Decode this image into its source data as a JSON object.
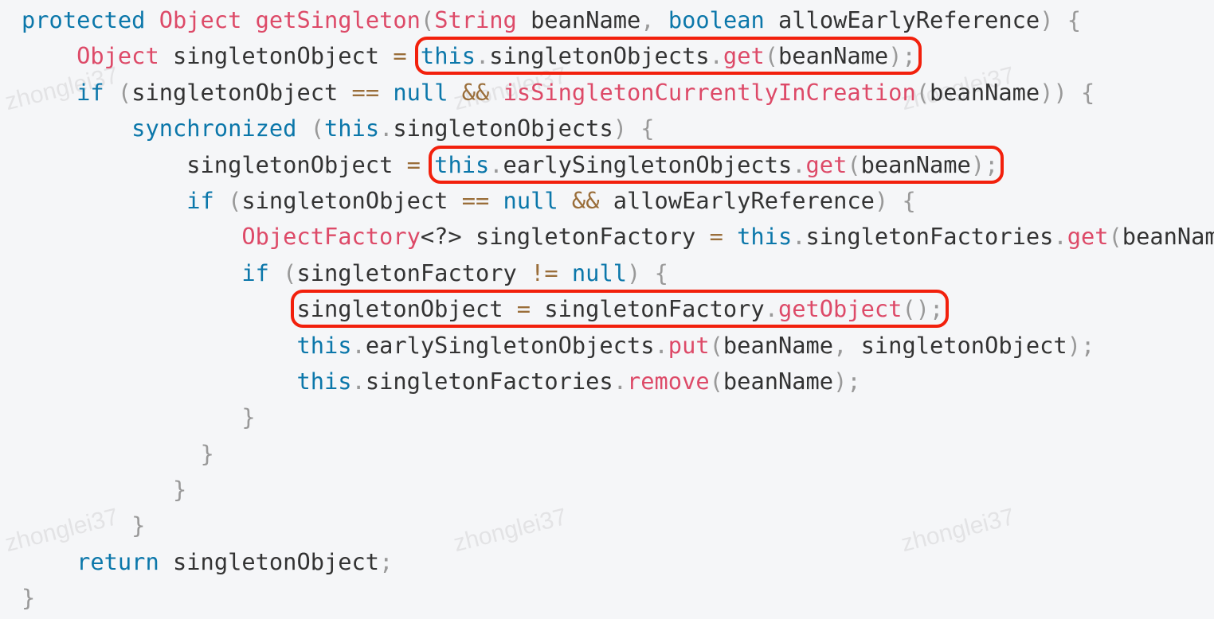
{
  "colors": {
    "keyword": "#0b77aa",
    "function": "#dd4a68",
    "operator": "#9a6e3a",
    "punctuation": "#999999",
    "text": "#333333",
    "highlight_box": "#f2200c",
    "background": "#f5f6f8"
  },
  "watermark": "zhonglei37",
  "code": [
    {
      "indent": 0,
      "tokens": [
        [
          "kw",
          "protected"
        ],
        [
          "t",
          " "
        ],
        [
          "fn",
          "Object"
        ],
        [
          "t",
          " "
        ],
        [
          "fn",
          "getSingleton"
        ],
        [
          "p",
          "("
        ],
        [
          "fn",
          "String"
        ],
        [
          "t",
          " beanName"
        ],
        [
          "p",
          ","
        ],
        [
          "t",
          " "
        ],
        [
          "kw",
          "boolean"
        ],
        [
          "t",
          " allowEarlyReference"
        ],
        [
          "p",
          ")"
        ],
        [
          "t",
          " "
        ],
        [
          "p",
          "{"
        ]
      ]
    },
    {
      "indent": 4,
      "tokens": [
        [
          "fn",
          "Object"
        ],
        [
          "t",
          " singletonObject "
        ],
        [
          "op",
          "="
        ],
        [
          "t",
          " "
        ],
        [
          "kw",
          "this"
        ],
        [
          "p",
          "."
        ],
        [
          "t",
          "singletonObjects"
        ],
        [
          "p",
          "."
        ],
        [
          "fn",
          "get"
        ],
        [
          "p",
          "("
        ],
        [
          "t",
          "beanName"
        ],
        [
          "p",
          ")"
        ],
        [
          "p",
          ";"
        ]
      ],
      "box": [
        4,
        12
      ]
    },
    {
      "indent": 4,
      "tokens": [
        [
          "kw",
          "if"
        ],
        [
          "t",
          " "
        ],
        [
          "p",
          "("
        ],
        [
          "t",
          "singletonObject "
        ],
        [
          "op",
          "=="
        ],
        [
          "t",
          " "
        ],
        [
          "kw",
          "null"
        ],
        [
          "t",
          " "
        ],
        [
          "op",
          "&&"
        ],
        [
          "t",
          " "
        ],
        [
          "fn",
          "isSingletonCurrentlyInCreation"
        ],
        [
          "p",
          "("
        ],
        [
          "t",
          "beanName"
        ],
        [
          "p",
          ")"
        ],
        [
          "p",
          ")"
        ],
        [
          "t",
          " "
        ],
        [
          "p",
          "{"
        ]
      ]
    },
    {
      "indent": 8,
      "tokens": [
        [
          "kw",
          "synchronized"
        ],
        [
          "t",
          " "
        ],
        [
          "p",
          "("
        ],
        [
          "kw",
          "this"
        ],
        [
          "p",
          "."
        ],
        [
          "t",
          "singletonObjects"
        ],
        [
          "p",
          ")"
        ],
        [
          "t",
          " "
        ],
        [
          "p",
          "{"
        ]
      ]
    },
    {
      "indent": 12,
      "tokens": [
        [
          "t",
          "singletonObject "
        ],
        [
          "op",
          "="
        ],
        [
          "t",
          " "
        ],
        [
          "kw",
          "this"
        ],
        [
          "p",
          "."
        ],
        [
          "t",
          "earlySingletonObjects"
        ],
        [
          "p",
          "."
        ],
        [
          "fn",
          "get"
        ],
        [
          "p",
          "("
        ],
        [
          "t",
          "beanName"
        ],
        [
          "p",
          ")"
        ],
        [
          "p",
          ";"
        ]
      ],
      "box": [
        3,
        11
      ]
    },
    {
      "indent": 12,
      "tokens": [
        [
          "kw",
          "if"
        ],
        [
          "t",
          " "
        ],
        [
          "p",
          "("
        ],
        [
          "t",
          "singletonObject "
        ],
        [
          "op",
          "=="
        ],
        [
          "t",
          " "
        ],
        [
          "kw",
          "null"
        ],
        [
          "t",
          " "
        ],
        [
          "op",
          "&&"
        ],
        [
          "t",
          " allowEarlyReference"
        ],
        [
          "p",
          ")"
        ],
        [
          "t",
          " "
        ],
        [
          "p",
          "{"
        ]
      ]
    },
    {
      "indent": 16,
      "tokens": [
        [
          "fn",
          "ObjectFactory"
        ],
        [
          "t",
          "<?> singletonFactory "
        ],
        [
          "op",
          "="
        ],
        [
          "t",
          " "
        ],
        [
          "kw",
          "this"
        ],
        [
          "p",
          "."
        ],
        [
          "t",
          "singletonFactories"
        ],
        [
          "p",
          "."
        ],
        [
          "fn",
          "get"
        ],
        [
          "p",
          "("
        ],
        [
          "t",
          "beanNam"
        ]
      ]
    },
    {
      "indent": 16,
      "tokens": [
        [
          "kw",
          "if"
        ],
        [
          "t",
          " "
        ],
        [
          "p",
          "("
        ],
        [
          "t",
          "singletonFactory "
        ],
        [
          "op",
          "!="
        ],
        [
          "t",
          " "
        ],
        [
          "kw",
          "null"
        ],
        [
          "p",
          ")"
        ],
        [
          "t",
          " "
        ],
        [
          "p",
          "{"
        ]
      ]
    },
    {
      "indent": 20,
      "tokens": [
        [
          "t",
          "singletonObject "
        ],
        [
          "op",
          "="
        ],
        [
          "t",
          " singletonFactory"
        ],
        [
          "p",
          "."
        ],
        [
          "fn",
          "getObject"
        ],
        [
          "p",
          "("
        ],
        [
          "p",
          ")"
        ],
        [
          "p",
          ";"
        ]
      ],
      "box": [
        0,
        7
      ]
    },
    {
      "indent": 20,
      "tokens": [
        [
          "kw",
          "this"
        ],
        [
          "p",
          "."
        ],
        [
          "t",
          "earlySingletonObjects"
        ],
        [
          "p",
          "."
        ],
        [
          "fn",
          "put"
        ],
        [
          "p",
          "("
        ],
        [
          "t",
          "beanName"
        ],
        [
          "p",
          ","
        ],
        [
          "t",
          " singletonObject"
        ],
        [
          "p",
          ")"
        ],
        [
          "p",
          ";"
        ]
      ]
    },
    {
      "indent": 20,
      "tokens": [
        [
          "kw",
          "this"
        ],
        [
          "p",
          "."
        ],
        [
          "t",
          "singletonFactories"
        ],
        [
          "p",
          "."
        ],
        [
          "fn",
          "remove"
        ],
        [
          "p",
          "("
        ],
        [
          "t",
          "beanName"
        ],
        [
          "p",
          ")"
        ],
        [
          "p",
          ";"
        ]
      ]
    },
    {
      "indent": 16,
      "tokens": [
        [
          "p",
          "}"
        ]
      ]
    },
    {
      "indent": 13,
      "tokens": [
        [
          "p",
          "}"
        ]
      ]
    },
    {
      "indent": 11,
      "tokens": [
        [
          "p",
          "}"
        ]
      ]
    },
    {
      "indent": 8,
      "tokens": [
        [
          "p",
          "}"
        ]
      ]
    },
    {
      "indent": 4,
      "tokens": [
        [
          "kw",
          "return"
        ],
        [
          "t",
          " singletonObject"
        ],
        [
          "p",
          ";"
        ]
      ]
    },
    {
      "indent": 0,
      "tokens": [
        [
          "p",
          "}"
        ]
      ]
    }
  ]
}
